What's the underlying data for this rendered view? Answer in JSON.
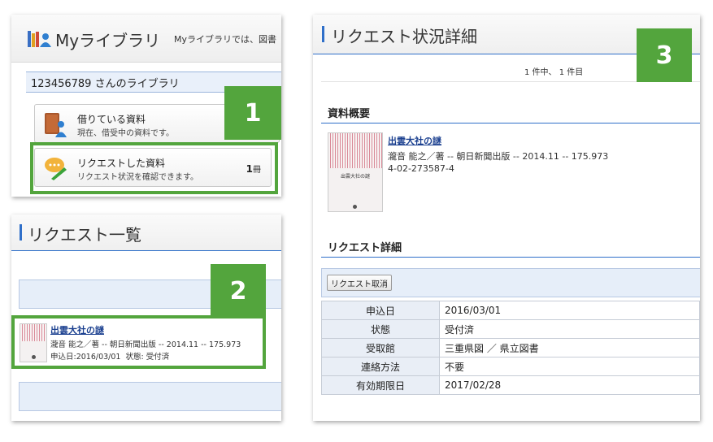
{
  "mylibrary": {
    "title": "Myライブラリ",
    "subtitle": "Myライブラリでは、図書",
    "user_line": "123456789 さんのライブラリ",
    "borrowed": {
      "title": "借りている資料",
      "desc": "現在、借受中の資料です。"
    },
    "requested": {
      "title": "リクエストした資料",
      "desc": "リクエスト状況を確認できます。",
      "count": "1",
      "unit": "冊"
    },
    "step": "1"
  },
  "request_list": {
    "title": "リクエスト一覧",
    "step": "2",
    "item": {
      "title": "出雲大社の謎",
      "meta": "瀧音 能之／著 -- 朝日新聞出版 -- 2014.11 -- 175.973",
      "status_line": "申込日:2016/03/01  状態: 受付済"
    }
  },
  "request_detail": {
    "title": "リクエスト状況詳細",
    "step": "3",
    "paging": "1 件中、 1 件目",
    "overview_heading": "資料概要",
    "book": {
      "title": "出雲大社の謎",
      "meta": "瀧音 能之／著 -- 朝日新聞出版 -- 2014.11 -- 175.973",
      "isbn": "4-02-273587-4",
      "cover_text": "出雲大社の謎"
    },
    "detail_heading": "リクエスト詳細",
    "cancel_button": "リクエスト取消",
    "rows": [
      {
        "label": "申込日",
        "value": "2016/03/01"
      },
      {
        "label": "状態",
        "value": "受付済"
      },
      {
        "label": "受取館",
        "value": "三重県図 ／ 県立図書"
      },
      {
        "label": "連絡方法",
        "value": "不要"
      },
      {
        "label": "有効期限日",
        "value": "2017/02/28"
      }
    ]
  },
  "colors": {
    "accent_green": "#53a53d",
    "accent_blue": "#2f6fc9",
    "link": "#1a3f8f"
  },
  "icons": [
    "books-person-icon",
    "book-person-icon",
    "speech-pen-icon"
  ]
}
